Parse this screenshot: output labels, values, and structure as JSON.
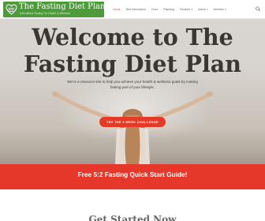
{
  "header": {
    "logo": {
      "title": "The Fasting Diet Plan",
      "tagline": "Intermittent Fasting For Health & Wellness"
    },
    "nav": [
      {
        "label": "Home",
        "active": true,
        "dropdown": false
      },
      {
        "label": "Diet Information",
        "active": false,
        "dropdown": false
      },
      {
        "label": "Food",
        "active": false,
        "dropdown": false
      },
      {
        "label": "Planning",
        "active": false,
        "dropdown": false
      },
      {
        "label": "Recipes",
        "active": false,
        "dropdown": true
      },
      {
        "label": "About",
        "active": false,
        "dropdown": true
      },
      {
        "label": "Member",
        "active": false,
        "dropdown": true
      }
    ],
    "search_icon": "search-icon"
  },
  "hero": {
    "title_line1": "Welcome to The",
    "title_line2": "Fasting Diet Plan",
    "subtitle": "We're a resource site to help you achieve your health & wellness goals by making fasting part of your lifestyle.",
    "cta": "TRY THE 4 WEEK CHALLENGE"
  },
  "banner": {
    "text": "Free 5:2 Fasting Quick Start Guide!"
  },
  "bottom": {
    "heading": "Get Started Now"
  },
  "colors": {
    "brand_green": "#4e9b3c",
    "accent_red": "#e33b28",
    "band_red": "#e5382a",
    "nav_active": "#e84b36"
  }
}
